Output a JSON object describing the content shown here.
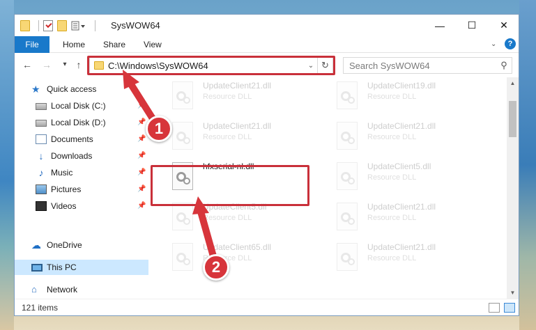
{
  "window": {
    "title": "SysWOW64",
    "minimize": "—",
    "maximize": "☐",
    "close": "✕"
  },
  "ribbon": {
    "tabs": [
      "File",
      "Home",
      "Share",
      "View"
    ],
    "help": "?"
  },
  "nav": {
    "back": "←",
    "forward": "→",
    "recent": "▾",
    "up": "↑",
    "address": "C:\\Windows\\SysWOW64",
    "search_placeholder": "Search SysWOW64"
  },
  "sidebar": {
    "items": [
      {
        "label": "Quick access",
        "icon": "star-icon"
      },
      {
        "label": "Local Disk (C:)",
        "icon": "disk-icon"
      },
      {
        "label": "Local Disk (D:)",
        "icon": "disk-icon"
      },
      {
        "label": "Documents",
        "icon": "documents-icon"
      },
      {
        "label": "Downloads",
        "icon": "download-icon"
      },
      {
        "label": "Music",
        "icon": "music-icon"
      },
      {
        "label": "Pictures",
        "icon": "pictures-icon"
      },
      {
        "label": "Videos",
        "icon": "videos-icon"
      },
      {
        "label": "OneDrive",
        "icon": "cloud-icon"
      },
      {
        "label": "This PC",
        "icon": "computer-icon"
      },
      {
        "label": "Network",
        "icon": "network-icon"
      }
    ]
  },
  "files": [
    {
      "name": "UpdateClient21.dll",
      "type": "Resource DLL"
    },
    {
      "name": "UpdateClient19.dll",
      "type": "Resource DLL"
    },
    {
      "name": "UpdateClient21.dll",
      "type": "Resource DLL"
    },
    {
      "name": "UpdateClient21.dll",
      "type": "Resource DLL"
    },
    {
      "name": "hfxserial-nl.dll",
      "type": ""
    },
    {
      "name": "UpdateClient5.dll",
      "type": "Resource DLL"
    },
    {
      "name": "UpdateClient5.dll",
      "type": "Resource DLL"
    },
    {
      "name": "UpdateClient21.dll",
      "type": "Resource DLL"
    },
    {
      "name": "UpdateClient65.dll",
      "type": "Resource DLL"
    },
    {
      "name": "UpdateClient21.dll",
      "type": "Resource DLL"
    }
  ],
  "status": {
    "item_count": "121 items"
  },
  "callouts": [
    "1",
    "2"
  ],
  "colors": {
    "accent": "#1979ca",
    "highlight": "#c9303a",
    "callout": "#d7353b",
    "selected_nav": "#cce8ff"
  }
}
